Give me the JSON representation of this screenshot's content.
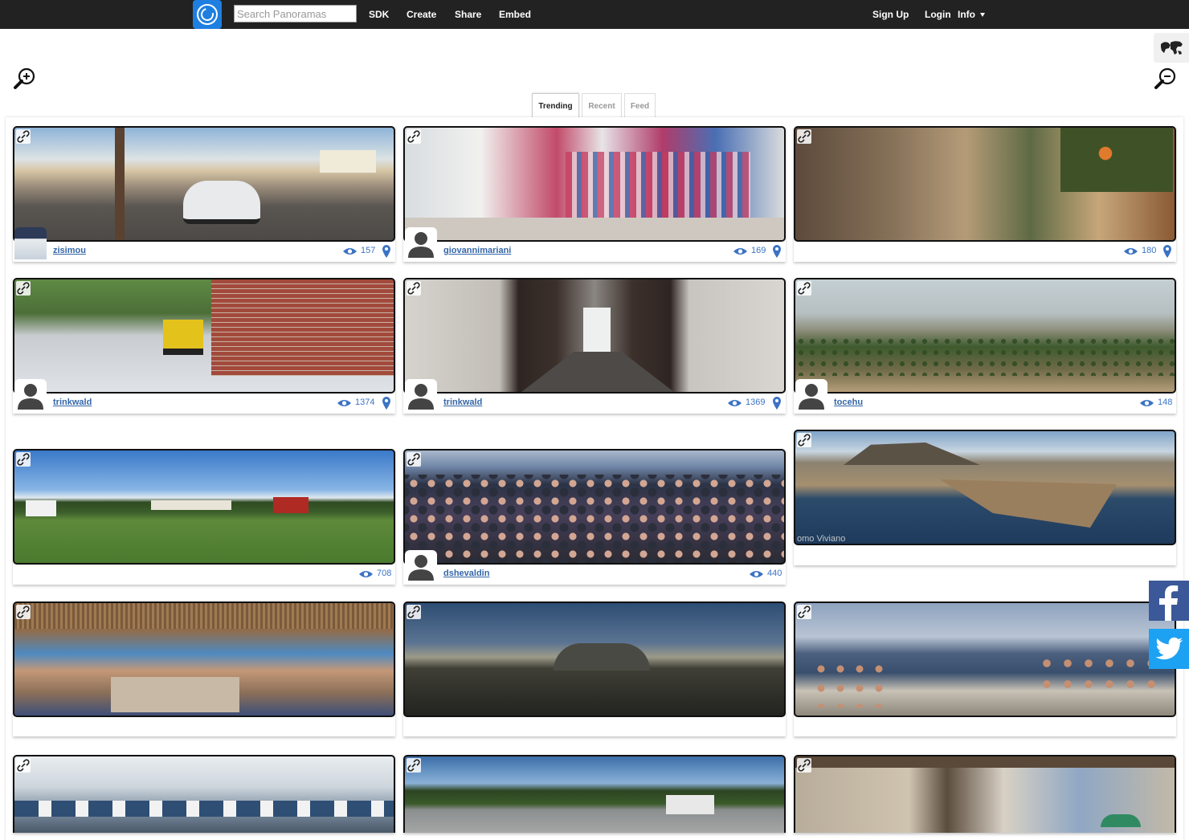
{
  "header": {
    "search_placeholder": "Search Panoramas",
    "nav_left": [
      "SDK",
      "Create",
      "Share",
      "Embed"
    ],
    "nav_right": [
      "Sign Up",
      "Login",
      "Info"
    ]
  },
  "tabs": [
    "Trending",
    "Recent",
    "Feed"
  ],
  "active_tab": "Trending",
  "colors": {
    "topbar": "#222222",
    "logo": "#1e7fe0",
    "link_blue": "#3466a8",
    "views_blue": "#3b73c4",
    "facebook": "#3b5998",
    "twitter": "#1da1f2"
  },
  "panoramas": [
    {
      "username": "zisimou",
      "views": "157",
      "avatar": "photo",
      "pin": true,
      "scene": "rural street with smart car at sunset"
    },
    {
      "username": "giovannimariani",
      "views": "169",
      "avatar": "default",
      "pin": true,
      "scene": "supermarket aisles"
    },
    {
      "username": "",
      "views": "180",
      "avatar": "none",
      "pin": true,
      "scene": "stone alley with orange tree"
    },
    {
      "username": "trinkwald",
      "views": "1374",
      "avatar": "default",
      "pin": true,
      "scene": "brick building construction site"
    },
    {
      "username": "trinkwald",
      "views": "1369",
      "avatar": "default",
      "pin": true,
      "scene": "corridor interior"
    },
    {
      "username": "tocehu",
      "views": "148",
      "avatar": "default",
      "pin": false,
      "scene": "mountain landscape with trees"
    },
    {
      "username": "",
      "views": "708",
      "avatar": "none",
      "pin": false,
      "scene": "green field under blue sky"
    },
    {
      "username": "dshevaldin",
      "views": "440",
      "avatar": "default",
      "pin": false,
      "scene": "crowd at outdoor event"
    },
    {
      "username": "",
      "views": "",
      "avatar": "none",
      "pin": false,
      "scene": "aerial coastline",
      "watermark": "omo Viviano"
    },
    {
      "username": "",
      "views": "",
      "avatar": "none",
      "pin": false,
      "scene": "beach bar under thatched roof"
    },
    {
      "username": "",
      "views": "",
      "avatar": "none",
      "pin": false,
      "scene": "dusk field with hangar"
    },
    {
      "username": "",
      "views": "",
      "avatar": "none",
      "pin": false,
      "scene": "seaside cliff dinner"
    },
    {
      "username": "",
      "views": "",
      "avatar": "none",
      "pin": false,
      "scene": "art gallery interior"
    },
    {
      "username": "",
      "views": "",
      "avatar": "none",
      "pin": false,
      "scene": "parking lot with trees"
    },
    {
      "username": "",
      "views": "",
      "avatar": "none",
      "pin": false,
      "scene": "porch with green umbrella"
    }
  ]
}
